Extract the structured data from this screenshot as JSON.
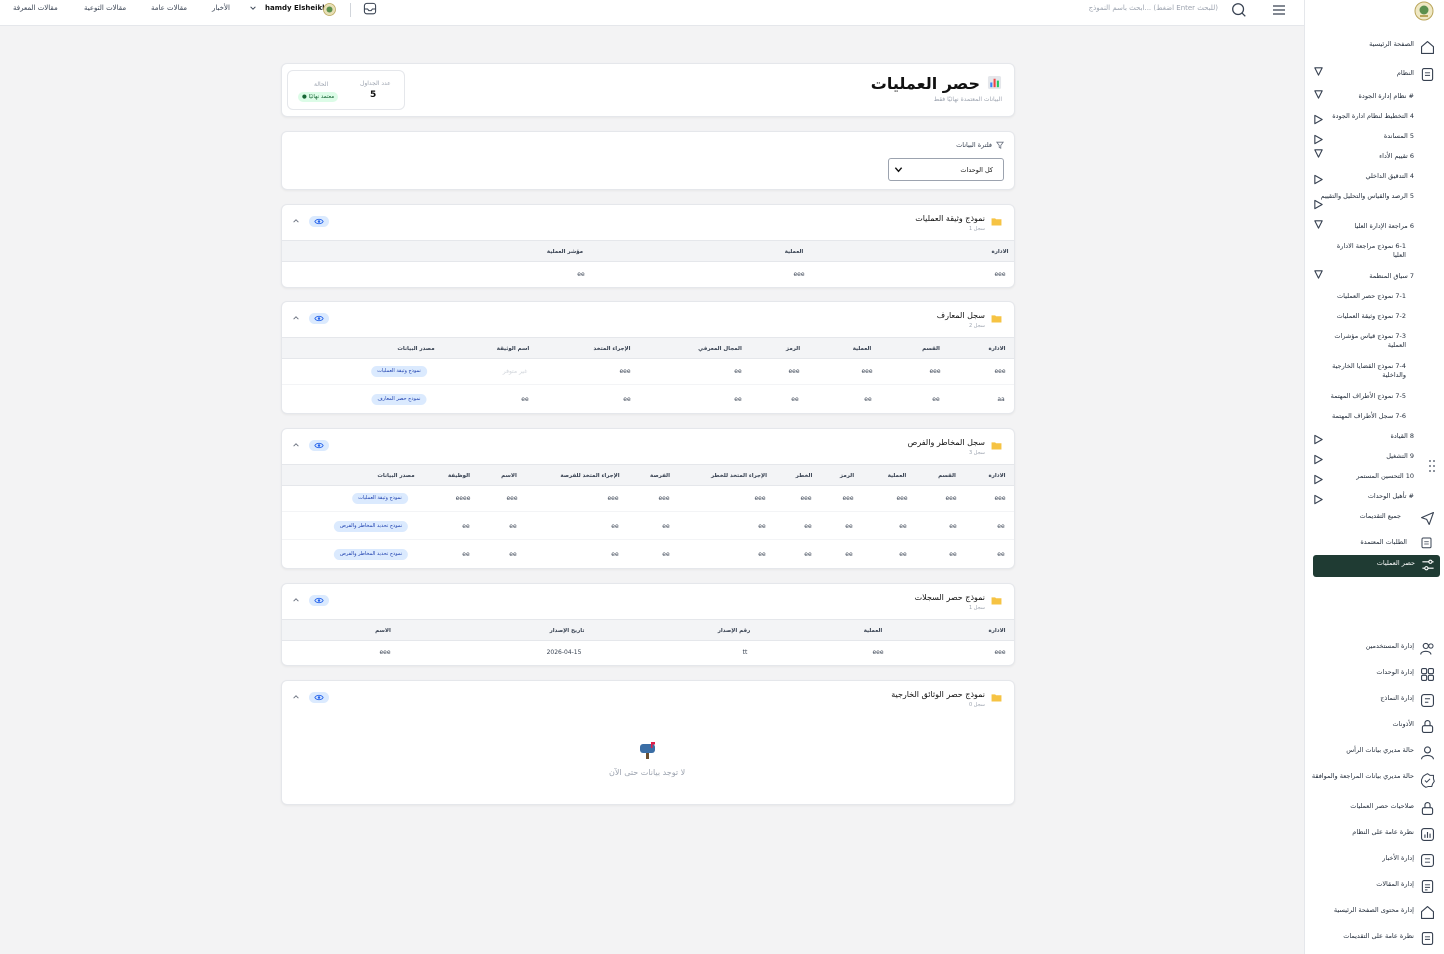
{
  "topbar": {
    "nav_links": [
      "مقالات المعرفة",
      "مقالات التوعية",
      "مقالات عامة",
      "الأخبار"
    ],
    "user_name": "hamdy Elsheikh",
    "search_placeholder": "ابحث باسم النموذج... (اضغط Enter للبحث)"
  },
  "sidebar": {
    "items": [
      "الصفحة الرئيسية",
      "النظام",
      "# نظام إدارة الجودة",
      "4 التخطيط لنظام ادارة الجودة",
      "5 المساندة",
      "6 تقييم الأداء",
      "4 التدقيق الداخلي",
      "5 الرصد والقياس والتحليل والتقييم",
      "6 مراجعة الإدارة العليا",
      "6-1 نموذج مراجعة الادارة العليا",
      "7 سياق المنظمة",
      "7-1 نموذج حصر العمليات",
      "7-2 نموذج وثيقة العمليات",
      "7-3 نموذج قياس مؤشرات العملية",
      "7-4 نموذج القضايا الخارجية والداخلية",
      "7-5 نموذج الأطراف المهتمة",
      "7-6 سجل الأطراف المهتمة",
      "8 القيادة",
      "9 التشغيل",
      "10 التحسين المستمر",
      "# تأهيل الوحدات",
      "جميع التقديمات",
      "الطلبات المعتمدة",
      "حصر العمليات"
    ],
    "admin_items": [
      "إدارة المستخدمين",
      "إدارة الوحدات",
      "إدارة النماذج",
      "الأذونات",
      "حالة مديري بيانات الرأس",
      "حالة مديري بيانات المراجعة والموافقة",
      "صلاحيات حصر العمليات",
      "نظرة عامة على النظام",
      "إدارة الأخبار",
      "إدارة المقالات",
      "إدارة محتوى الصفحة الرئيسية",
      "نظرة عامة على التقديمات"
    ]
  },
  "header": {
    "title": "حصر العمليات",
    "subtitle": "البيانات المعتمدة نهائيًا فقط",
    "stats": {
      "tables_label": "عدد الجداول",
      "tables_value": "5",
      "status_label": "الحالة",
      "status_badge": "معتمد نهائيًا"
    }
  },
  "filter": {
    "label": "فلترة البيانات",
    "selected": "كل الوحدات"
  },
  "sections": [
    {
      "title": "نموذج وثيقة العمليات",
      "count": "1 سجل",
      "columns": [
        "الادارة",
        "العملية",
        "مؤشر العملية"
      ],
      "rows": [
        [
          "eee",
          "eee",
          "ee"
        ]
      ]
    },
    {
      "title": "سجل المعارف",
      "count": "2 سجل",
      "columns": [
        "الادارة",
        "القسم",
        "العملية",
        "الرمز",
        "المجال المعرفي",
        "الإجراء المتخذ",
        "اسم الوثيقة",
        "مصدر البيانات"
      ],
      "rows": [
        [
          "eee",
          "eee",
          "eee",
          "eee",
          "ee",
          "eee",
          "غير متوفر",
          "نموذج وثيقة العمليات"
        ],
        [
          "aa",
          "ee",
          "ee",
          "ee",
          "ee",
          "ee",
          "ee",
          "نموذج حصر المعارف"
        ]
      ]
    },
    {
      "title": "سجل المخاطر والفرص",
      "count": "3 سجل",
      "columns": [
        "الادارة",
        "القسم",
        "العملية",
        "الرمز",
        "الخطر",
        "الإجراء المتخذ للخطر",
        "الفرصة",
        "الإجراء المتخذ للفرصة",
        "الاسم",
        "الوظيفة",
        "مصدر البيانات"
      ],
      "rows": [
        [
          "eee",
          "eee",
          "eee",
          "eee",
          "eee",
          "eee",
          "eee",
          "eee",
          "eee",
          "eeee",
          "نموذج وثيقة العمليات"
        ],
        [
          "ee",
          "ee",
          "ee",
          "ee",
          "ee",
          "ee",
          "ee",
          "ee",
          "ee",
          "ee",
          "نموذج تحديد المخاطر والفرص"
        ],
        [
          "ee",
          "ee",
          "ee",
          "ee",
          "ee",
          "ee",
          "ee",
          "ee",
          "ee",
          "ee",
          "نموذج تحديد المخاطر والفرص"
        ]
      ]
    },
    {
      "title": "نموذج حصر السجلات",
      "count": "1 سجل",
      "columns": [
        "الادارة",
        "العملية",
        "رقم الإصدار",
        "تاريخ الإصدار",
        "الاسم"
      ],
      "rows": [
        [
          "eee",
          "eee",
          "tt",
          "2026-04-15",
          "eee"
        ]
      ]
    },
    {
      "title": "نموذج حصر الوثائق الخارجية",
      "count": "0 سجل",
      "empty_text": "لا توجد بيانات حتى الآن"
    }
  ],
  "colors": {
    "active_bg": "#1f3b33",
    "badge_green": "#dcfce7",
    "pill_blue": "#dbeafe"
  }
}
